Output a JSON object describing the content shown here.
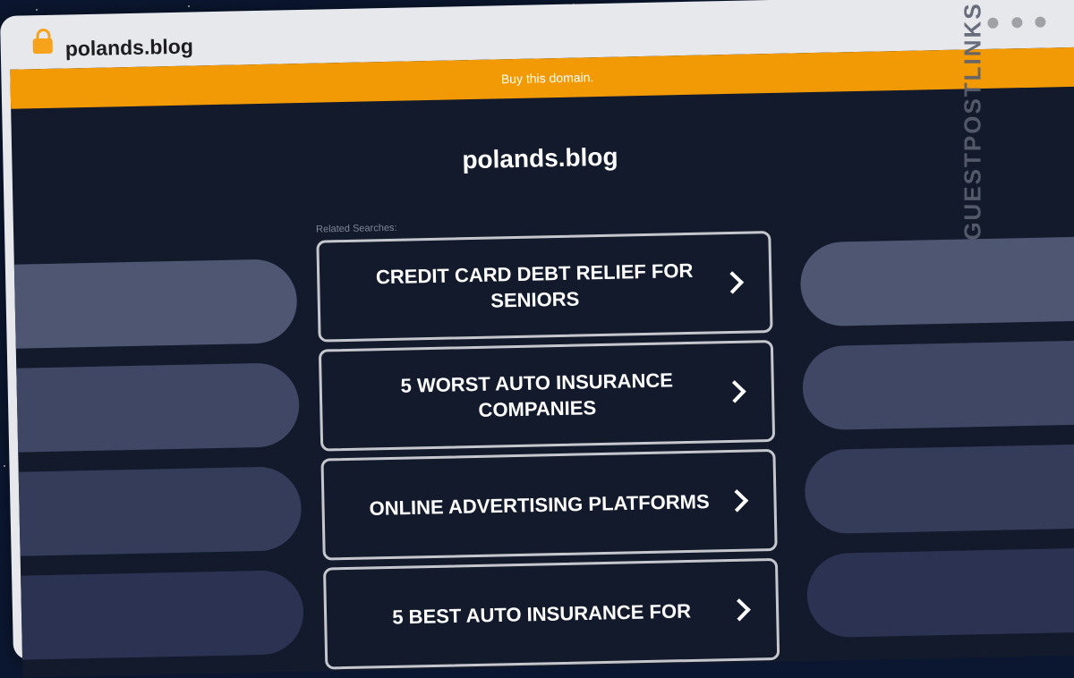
{
  "browser": {
    "url_title": "polands.blog"
  },
  "banner": {
    "text": "Buy this domain."
  },
  "page": {
    "domain": "polands.blog",
    "related_label": "Related Searches:"
  },
  "searches": [
    {
      "label": "CREDIT CARD DEBT RELIEF FOR SENIORS"
    },
    {
      "label": "5 WORST AUTO INSURANCE COMPANIES"
    },
    {
      "label": "ONLINE ADVERTISING PLATFORMS"
    },
    {
      "label": "5 BEST AUTO INSURANCE FOR"
    }
  ],
  "watermark": {
    "text": "GUESTPOSTLINKS"
  },
  "colors": {
    "banner": "#f29a06",
    "background": "#121a2b",
    "accent_lock": "#f7a21b"
  }
}
